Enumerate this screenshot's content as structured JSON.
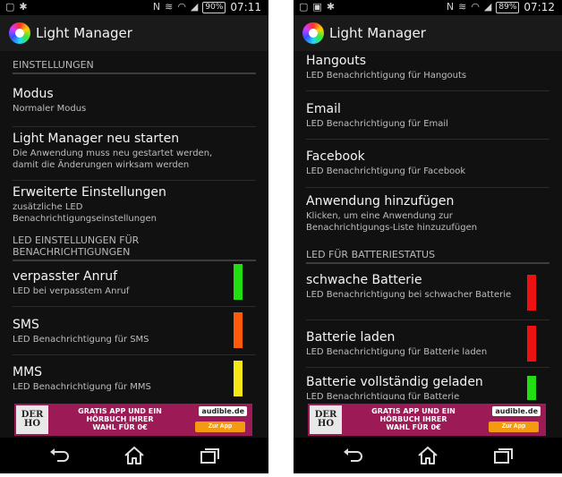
{
  "status_bar": [
    {
      "battery": "90%",
      "time": "07:11"
    },
    {
      "battery": "89%",
      "time": "07:12"
    }
  ],
  "app": {
    "title": "Light Manager"
  },
  "screen_left": {
    "section_settings": "EINSTELLUNGEN",
    "mode": {
      "title": "Modus",
      "subtitle": "Normaler Modus"
    },
    "restart": {
      "title": "Light Manager neu starten",
      "subtitle": "Die Anwendung muss neu gestartet werden, damit die Änderungen wirksam werden"
    },
    "advanced": {
      "title": "Erweiterte Einstellungen",
      "subtitle": "zusätzliche LED Benachrichtigungseinstellungen"
    },
    "section_led": "LED EINSTELLUNGEN FÜR BENACHRICHTIGUNGEN",
    "items": [
      {
        "title": "verpasster Anruf",
        "subtitle": "LED bei verpasstem Anruf",
        "color": "#22dd11"
      },
      {
        "title": "SMS",
        "subtitle": "LED Benachrichtigung für SMS",
        "color": "#ff5a0a"
      },
      {
        "title": "MMS",
        "subtitle": "LED Benachrichtigung für MMS",
        "color": "#f5e617"
      }
    ]
  },
  "screen_right": {
    "items": [
      {
        "title": "Hangouts",
        "subtitle": "LED Benachrichtigung für Hangouts"
      },
      {
        "title": "Email",
        "subtitle": "LED Benachrichtigung für Email"
      },
      {
        "title": "Facebook",
        "subtitle": "LED Benachrichtigung für Facebook"
      }
    ],
    "add_app": {
      "title": "Anwendung hinzufügen",
      "subtitle": "Klicken, um eine Anwendung zur Benachrichtigungs-Liste hinzuzufügen"
    },
    "section_battery": "LED FÜR BATTERIESTATUS",
    "battery_items": [
      {
        "title": "schwache Batterie",
        "subtitle": "LED Benachrichtigung bei schwacher Batterie",
        "color": "#ee1111"
      },
      {
        "title": "Batterie laden",
        "subtitle": "LED Benachrichtigung für Batterie laden",
        "color": "#ee1111"
      },
      {
        "title": "Batterie vollständig geladen",
        "subtitle": "LED Benachrichtigung für Batterie",
        "color": "#22dd11"
      }
    ]
  },
  "ad": {
    "book": "DER\nHO",
    "text": "GRATIS APP UND EIN\nHÖRBUCH IHRER\nWAHL FÜR 0€",
    "brand": "audible.de",
    "button": "Zur App"
  },
  "icons": {
    "status": [
      "sim-icon",
      "usb-icon",
      "nfc-icon",
      "vibrate-icon",
      "wifi-icon",
      "signal-icon",
      "battery-icon"
    ],
    "nav": [
      "back-icon",
      "home-icon",
      "recent-apps-icon"
    ]
  }
}
